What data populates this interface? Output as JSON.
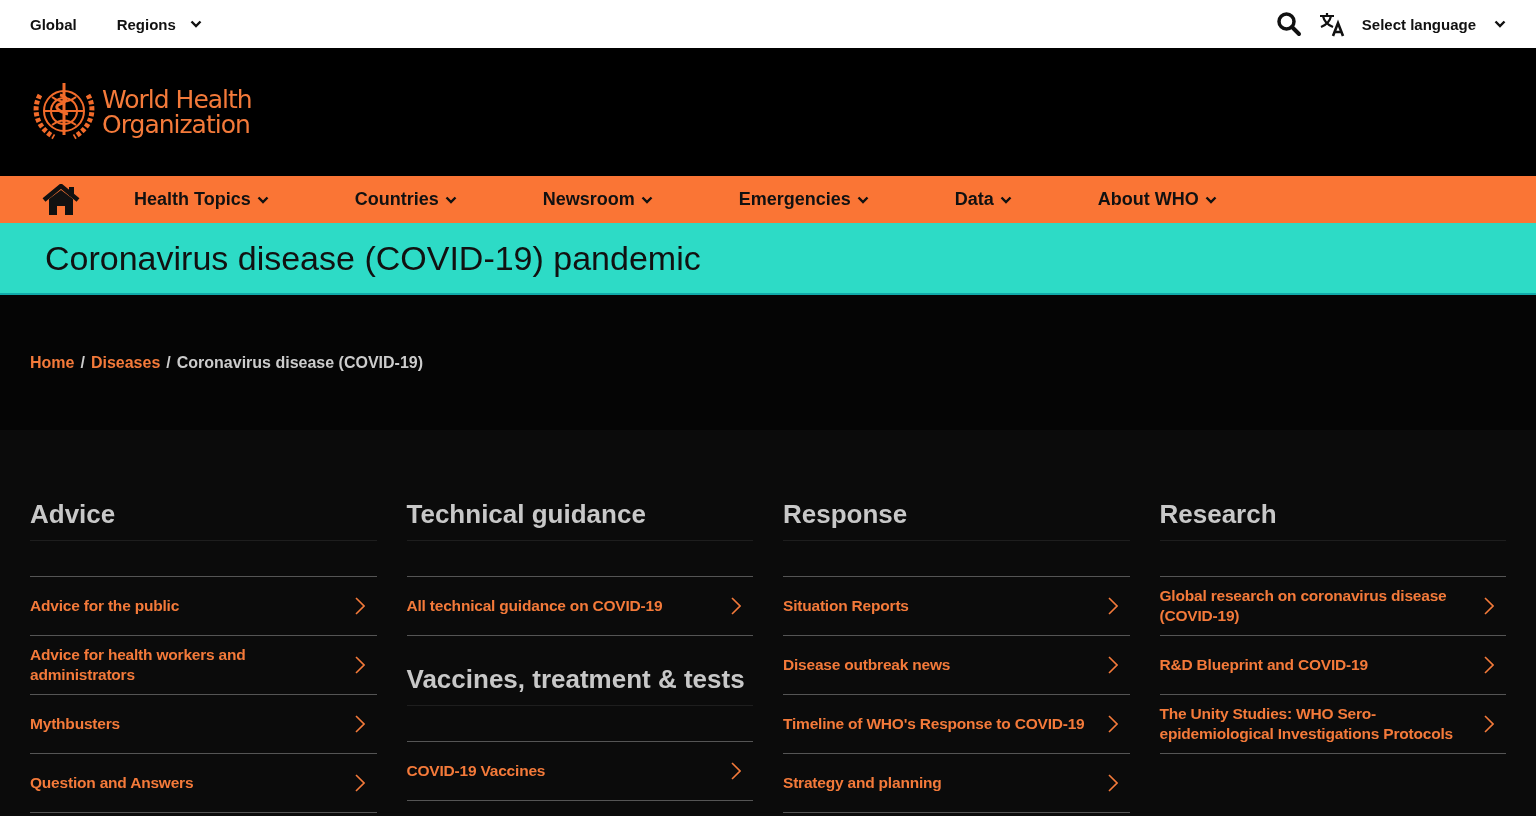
{
  "topbar": {
    "items": [
      {
        "label": "Global",
        "dropdown": false
      },
      {
        "label": "Regions",
        "dropdown": true
      }
    ],
    "language": "Select language"
  },
  "logo": {
    "line1": "World Health",
    "line2": "Organization"
  },
  "nav": [
    {
      "label": "Health Topics"
    },
    {
      "label": "Countries"
    },
    {
      "label": "Newsroom"
    },
    {
      "label": "Emergencies"
    },
    {
      "label": "Data"
    },
    {
      "label": "About WHO"
    }
  ],
  "banner": {
    "title": "Coronavirus disease (COVID-19) pandemic"
  },
  "breadcrumb": {
    "separator": "/",
    "items": [
      {
        "label": "Home",
        "link": true
      },
      {
        "label": "Diseases",
        "link": true
      },
      {
        "label": "Coronavirus disease (COVID-19)",
        "link": false
      }
    ]
  },
  "columns": [
    {
      "sections": [
        {
          "heading": "Advice",
          "links": [
            "Advice for the public",
            "Advice for health workers and administrators",
            "Mythbusters",
            "Question and Answers"
          ]
        }
      ]
    },
    {
      "sections": [
        {
          "heading": "Technical guidance",
          "links": [
            "All technical guidance on COVID-19"
          ]
        },
        {
          "heading": "Vaccines, treatment & tests",
          "links": [
            "COVID-19 Vaccines"
          ]
        }
      ]
    },
    {
      "sections": [
        {
          "heading": "Response",
          "links": [
            "Situation Reports",
            "Disease outbreak news",
            "Timeline of WHO's Response to COVID-19",
            "Strategy and planning"
          ]
        }
      ]
    },
    {
      "sections": [
        {
          "heading": "Research",
          "links": [
            "Global research on coronavirus disease (COVID-19)",
            "R&D Blueprint and COVID-19",
            "The Unity Studies: WHO Sero-epidemiological Investigations Protocols"
          ]
        }
      ]
    }
  ]
}
